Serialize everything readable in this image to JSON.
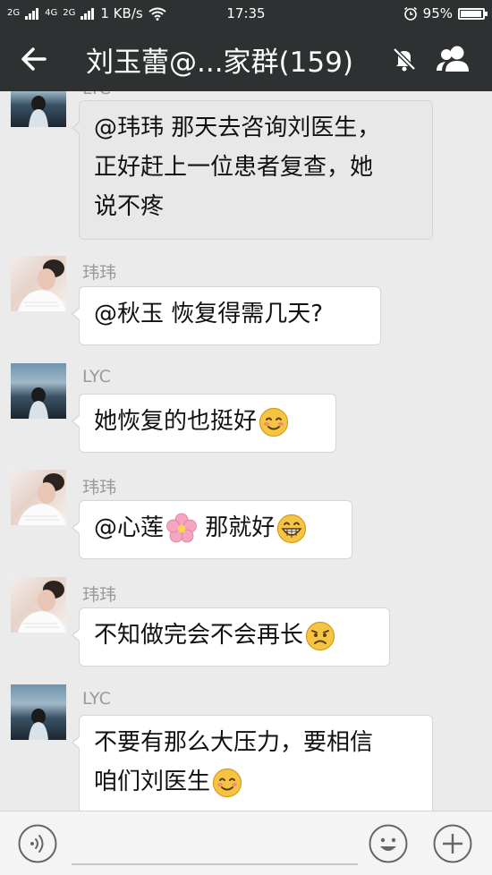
{
  "status_bar": {
    "signal_1": "2G",
    "signal_2": "4G",
    "signal_3": "2G",
    "net_speed": "1 KB/s",
    "time": "17:35",
    "battery": "95%",
    "battery_level": 0.95
  },
  "header": {
    "title": "刘玉蕾@...家群(159)"
  },
  "messages": [
    {
      "sender": "LYC",
      "avatar": "lyc",
      "lines": [
        "@玮玮  那天去咨询刘医生，",
        "正好赶上一位患者复查，她",
        "说不疼"
      ],
      "emoji": ""
    },
    {
      "sender": "玮玮",
      "avatar": "wei",
      "lines": [
        "@秋玉  恢复得需几天?"
      ],
      "emoji": ""
    },
    {
      "sender": "LYC",
      "avatar": "lyc",
      "lines": [
        "她恢复的也挺好"
      ],
      "emoji": "smile"
    },
    {
      "sender": "玮玮",
      "avatar": "wei",
      "lines": [
        "@心莲",
        " 那就好"
      ],
      "emoji": "grin"
    },
    {
      "sender": "玮玮",
      "avatar": "wei",
      "lines": [
        "不知做完会不会再长"
      ],
      "emoji": "sad"
    },
    {
      "sender": "LYC",
      "avatar": "lyc",
      "lines": [
        "不要有那么大压力，要相信",
        "咱们刘医生"
      ],
      "emoji": "smile"
    }
  ],
  "icons": {
    "back": "arrow-left-icon",
    "mute": "bell-muted-icon",
    "members": "group-members-icon",
    "voice": "voice-icon",
    "emoji": "emoji-icon",
    "plus": "plus-icon",
    "flower": "flower-emoji-icon"
  },
  "colors": {
    "header_bg": "#2e3132",
    "chat_bg": "#ebebeb",
    "bubble_bg": "#ffffff",
    "sender_text": "#9a9a9a",
    "emoji_yellow": "#f6c443"
  }
}
